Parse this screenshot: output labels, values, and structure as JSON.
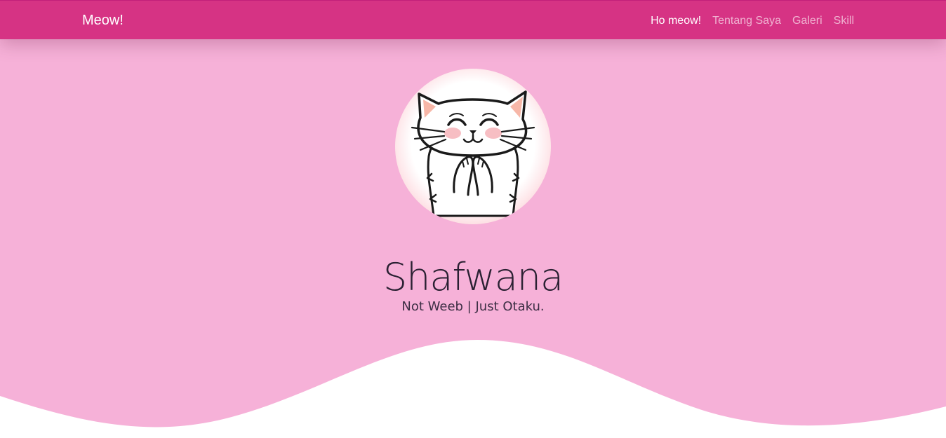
{
  "navbar": {
    "brand": "Meow!",
    "links": [
      {
        "label": "Ho meow!",
        "active": true
      },
      {
        "label": "Tentang Saya",
        "active": false
      },
      {
        "label": "Galeri",
        "active": false
      },
      {
        "label": "Skill",
        "active": false
      }
    ],
    "color": "#d63384"
  },
  "hero": {
    "avatar_icon": "cat-avatar-icon",
    "name": "Shafwana",
    "tagline": "Not Weeb | Just Otaku.",
    "background": "#f6b1d8",
    "wave_color": "#ffffff"
  }
}
